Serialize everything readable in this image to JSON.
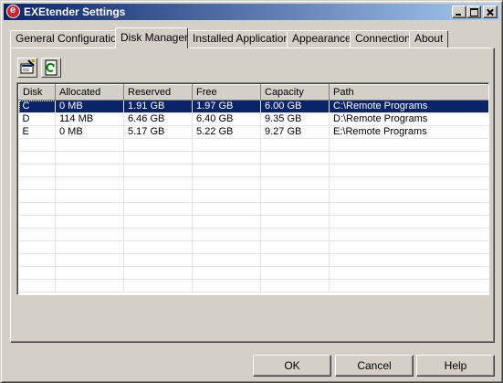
{
  "window": {
    "title": "EXEtender Settings",
    "icon_letter": "e"
  },
  "tabs": [
    {
      "label": "General Configuration",
      "active": false
    },
    {
      "label": "Disk Manager",
      "active": true
    },
    {
      "label": "Installed Applications",
      "active": false
    },
    {
      "label": "Appearance",
      "active": false
    },
    {
      "label": "Connection",
      "active": false
    },
    {
      "label": "About",
      "active": false
    }
  ],
  "toolbar": {
    "buttons": [
      "properties-icon",
      "refresh-icon"
    ]
  },
  "table": {
    "columns": [
      "Disk",
      "Allocated",
      "Reserved",
      "Free",
      "Capacity",
      "Path"
    ],
    "rows": [
      [
        "C",
        "0 MB",
        "1.91 GB",
        "1.97 GB",
        "6.00 GB",
        "C:\\Remote Programs"
      ],
      [
        "D",
        "114 MB",
        "6.46 GB",
        "6.40 GB",
        "9.35 GB",
        "D:\\Remote Programs"
      ],
      [
        "E",
        "0 MB",
        "5.17 GB",
        "5.22 GB",
        "9.27 GB",
        "E:\\Remote Programs"
      ]
    ],
    "selected_row": 0
  },
  "buttons": {
    "ok": "OK",
    "cancel": "Cancel",
    "help": "Help"
  },
  "colors": {
    "titlebar_start": "#0a246a",
    "titlebar_end": "#a6caf0",
    "selection": "#0a246a",
    "face": "#d4d0c8"
  }
}
